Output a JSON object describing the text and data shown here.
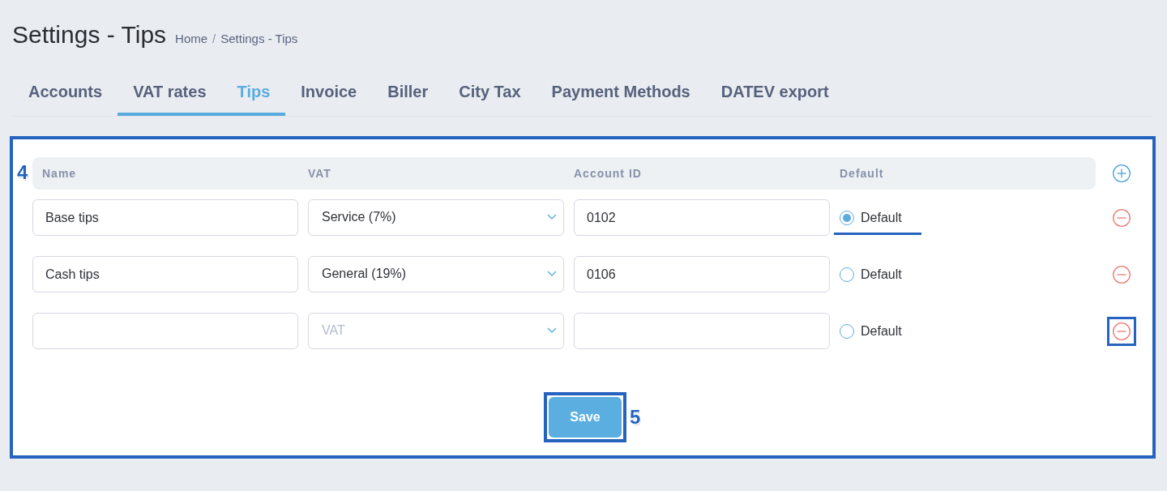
{
  "page": {
    "title": "Settings - Tips",
    "breadcrumb": [
      {
        "label": "Home"
      },
      {
        "label": "Settings - Tips"
      }
    ],
    "breadcrumb_separator": "/"
  },
  "tabs": [
    {
      "label": "Accounts",
      "selected": false,
      "underlined": false
    },
    {
      "label": "VAT rates",
      "selected": false,
      "underlined": true
    },
    {
      "label": "Tips",
      "selected": true,
      "underlined": true
    },
    {
      "label": "Invoice",
      "selected": false,
      "underlined": false
    },
    {
      "label": "Biller",
      "selected": false,
      "underlined": false
    },
    {
      "label": "City Tax",
      "selected": false,
      "underlined": false
    },
    {
      "label": "Payment Methods",
      "selected": false,
      "underlined": false
    },
    {
      "label": "DATEV export",
      "selected": false,
      "underlined": false
    }
  ],
  "panel": {
    "highlighted": true,
    "callout": "4",
    "columns": [
      "Name",
      "VAT",
      "Account ID",
      "Default"
    ],
    "rows": [
      {
        "name": "Base tips",
        "vat": "Service (7%)",
        "account_id": "0102",
        "default": {
          "label": "Default",
          "selected": true,
          "underlined": true
        },
        "remove_highlighted": false
      },
      {
        "name": "Cash tips",
        "vat": "General (19%)",
        "account_id": "0106",
        "default": {
          "label": "Default",
          "selected": false,
          "underlined": false
        },
        "remove_highlighted": false
      },
      {
        "vat_placeholder": "VAT",
        "default": {
          "label": "Default",
          "selected": false,
          "underlined": false
        },
        "remove_highlighted": true
      }
    ]
  },
  "save_button": {
    "label": "Save",
    "highlighted": true,
    "callout": "5"
  }
}
